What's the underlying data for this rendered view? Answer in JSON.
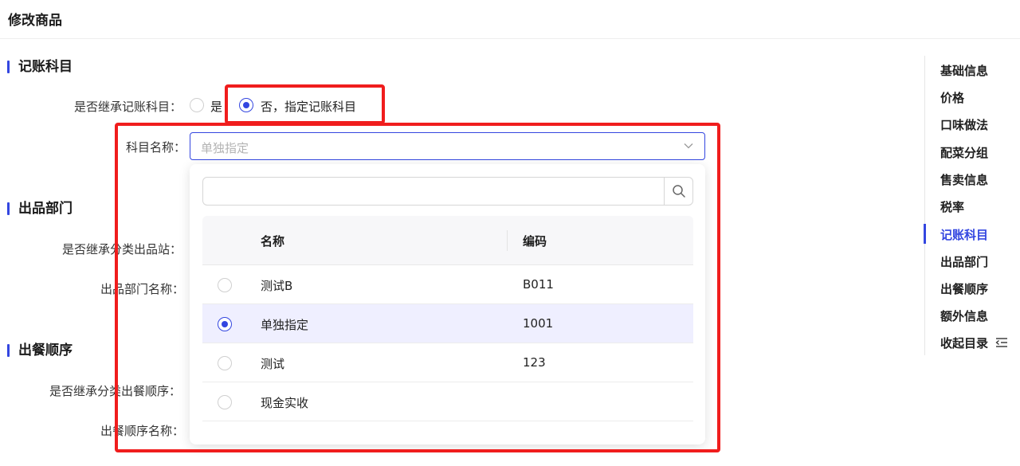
{
  "header": {
    "title": "修改商品"
  },
  "sections": {
    "accounting": {
      "title": "记账科目",
      "inherit_label": "是否继承记账科目：",
      "option_yes": "是",
      "option_no": "否，指定记账科目",
      "subject_label": "科目名称：",
      "subject_placeholder": "单独指定"
    },
    "department": {
      "title": "出品部门",
      "inherit_label": "是否继承分类出品站：",
      "name_label": "出品部门名称："
    },
    "meal_order": {
      "title": "出餐顺序",
      "inherit_label": "是否继承分类出餐顺序：",
      "name_label": "出餐顺序名称："
    }
  },
  "dropdown": {
    "search_placeholder": "",
    "columns": {
      "name": "名称",
      "code": "编码"
    },
    "rows": [
      {
        "name": "测试B",
        "code": "B011",
        "selected": false
      },
      {
        "name": "单独指定",
        "code": "1001",
        "selected": true
      },
      {
        "name": "测试",
        "code": "123",
        "selected": false
      },
      {
        "name": "现金实收",
        "code": "",
        "selected": false
      }
    ]
  },
  "toc": {
    "items": [
      "基础信息",
      "价格",
      "口味做法",
      "配菜分组",
      "售卖信息",
      "税率",
      "记账科目",
      "出品部门",
      "出餐顺序",
      "额外信息"
    ],
    "active_index": 6,
    "collapse_label": "收起目录"
  },
  "colors": {
    "accent": "#3346e0",
    "highlight": "#f01d1d",
    "selected_row": "#efefff"
  },
  "icons": {
    "select_arrow": "chevron-down-icon",
    "search": "search-icon",
    "collapse": "collapse-list-icon"
  }
}
